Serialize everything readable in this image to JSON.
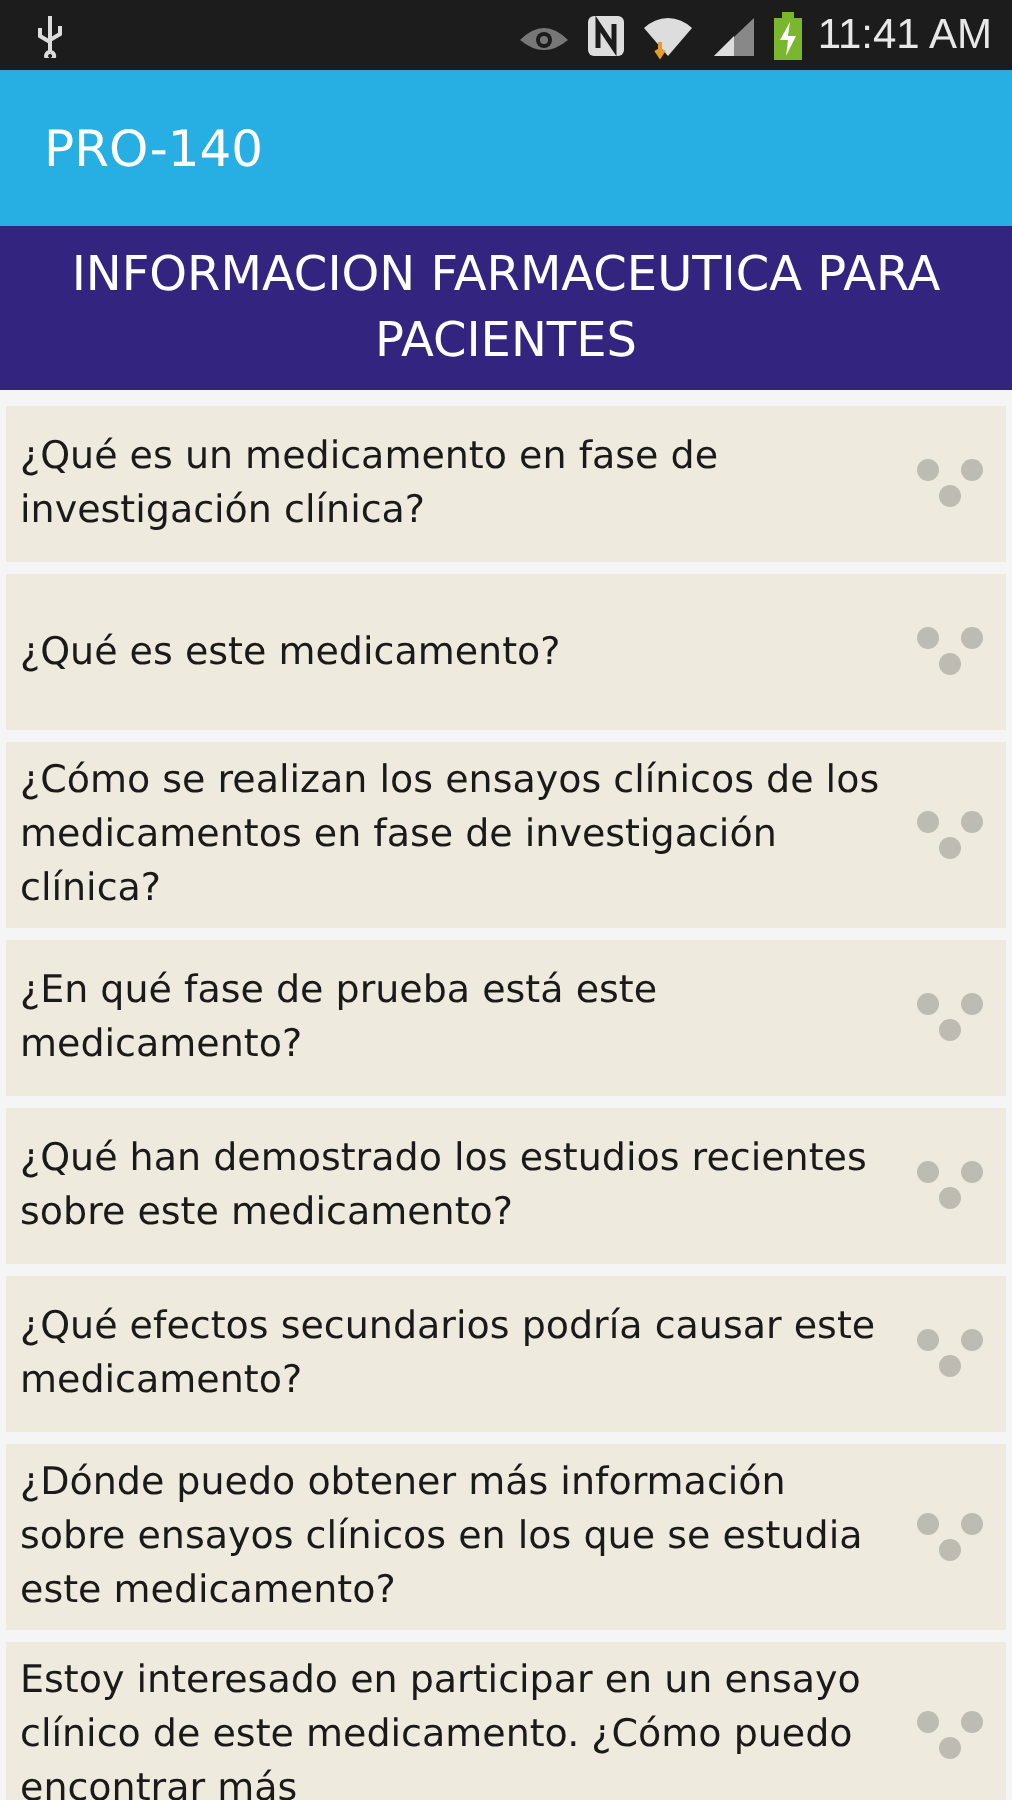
{
  "status_bar": {
    "time": "11:41 AM"
  },
  "app_bar": {
    "title": "PRO-140"
  },
  "header": {
    "title": "INFORMACION FARMACEUTICA PARA PACIENTES"
  },
  "items": [
    {
      "text": "¿Qué es un medicamento en fase de investigación clínica?"
    },
    {
      "text": "¿Qué es este medicamento?"
    },
    {
      "text": "¿Cómo se realizan los ensayos clínicos de los medicamentos en fase de investigación clínica?"
    },
    {
      "text": "¿En qué fase de prueba está este medicamento?"
    },
    {
      "text": "¿Qué han demostrado los estudios recientes sobre este medicamento?"
    },
    {
      "text": "¿Qué efectos secundarios podría causar este medicamento?"
    },
    {
      "text": "¿Dónde puedo obtener más información sobre ensayos clínicos en los que se estudia este medicamento?"
    },
    {
      "text": "Estoy interesado en participar en un ensayo clínico de este medicamento. ¿Cómo puedo encontrar más"
    }
  ]
}
